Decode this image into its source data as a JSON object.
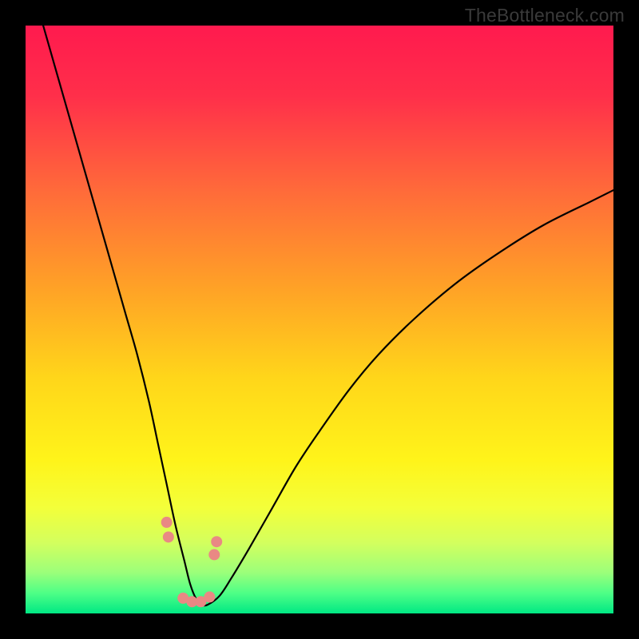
{
  "watermark": "TheBottleneck.com",
  "chart_data": {
    "type": "line",
    "title": "",
    "xlabel": "",
    "ylabel": "",
    "xlim": [
      0,
      100
    ],
    "ylim": [
      0,
      100
    ],
    "grid": false,
    "legend": false,
    "gradient_stops": [
      {
        "offset": 0.0,
        "color": "#ff1a4e"
      },
      {
        "offset": 0.12,
        "color": "#ff2f4a"
      },
      {
        "offset": 0.28,
        "color": "#ff6a3a"
      },
      {
        "offset": 0.45,
        "color": "#ffa326"
      },
      {
        "offset": 0.6,
        "color": "#ffd61a"
      },
      {
        "offset": 0.74,
        "color": "#fff41a"
      },
      {
        "offset": 0.82,
        "color": "#f3ff3a"
      },
      {
        "offset": 0.88,
        "color": "#d3ff5e"
      },
      {
        "offset": 0.93,
        "color": "#9cff7a"
      },
      {
        "offset": 0.965,
        "color": "#4fff86"
      },
      {
        "offset": 1.0,
        "color": "#00e884"
      }
    ],
    "series": [
      {
        "name": "bottleneck-curve",
        "color": "#000000",
        "width": 2.2,
        "x": [
          3,
          5,
          7,
          9,
          11,
          13,
          15,
          17,
          19,
          21,
          22.5,
          24,
          25.5,
          27,
          28,
          29,
          30,
          31,
          33,
          35,
          38,
          42,
          46,
          50,
          55,
          60,
          66,
          73,
          80,
          88,
          96,
          100
        ],
        "y": [
          100,
          93,
          86,
          79,
          72,
          65,
          58,
          51,
          44,
          36,
          29,
          22,
          15,
          9,
          5,
          2.5,
          1.5,
          1.5,
          3,
          6,
          11,
          18,
          25,
          31,
          38,
          44,
          50,
          56,
          61,
          66,
          70,
          72
        ]
      },
      {
        "name": "marker-cluster",
        "type": "scatter",
        "color": "#e98984",
        "radius": 7,
        "x": [
          24.0,
          24.3,
          26.8,
          28.3,
          29.8,
          31.3,
          32.1,
          32.5
        ],
        "y": [
          15.5,
          13.0,
          2.6,
          2.0,
          2.0,
          2.8,
          10.0,
          12.2
        ]
      }
    ]
  }
}
